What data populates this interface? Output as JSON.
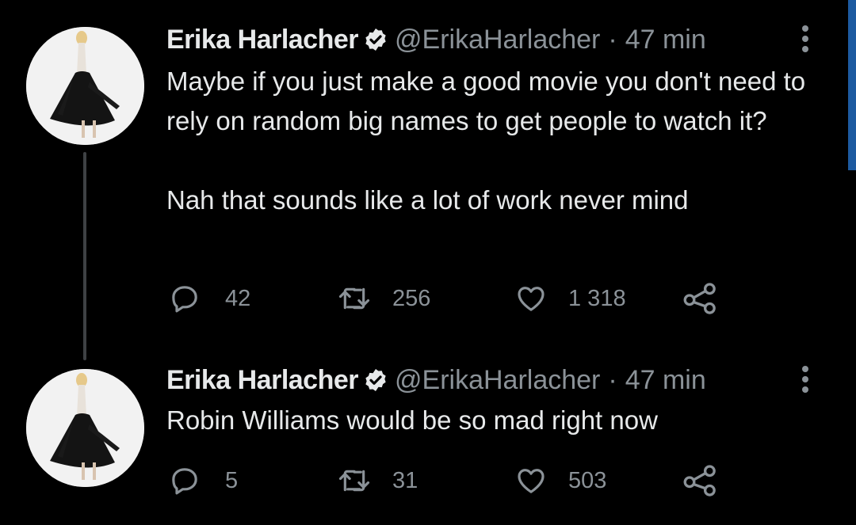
{
  "accent_color": "#1d9bf0",
  "tweets": [
    {
      "author_name": "Erika Harlacher",
      "handle": "@ErikaHarlacher",
      "separator": "·",
      "time": "47 min",
      "text": "Maybe if you just make a good movie you don't need to rely on random big names to get people to watch it?\n\nNah that sounds like a lot of work never mind",
      "replies": "42",
      "retweets": "256",
      "likes": "1 318"
    },
    {
      "author_name": "Erika Harlacher",
      "handle": "@ErikaHarlacher",
      "separator": "·",
      "time": "47 min",
      "text": "Robin Williams would be so mad right now",
      "replies": "5",
      "retweets": "31",
      "likes": "503"
    }
  ],
  "icons": {
    "verified": "verified-badge-icon",
    "more": "more-vertical-icon",
    "reply": "reply-icon",
    "retweet": "retweet-icon",
    "like": "heart-icon",
    "share": "share-icon"
  }
}
